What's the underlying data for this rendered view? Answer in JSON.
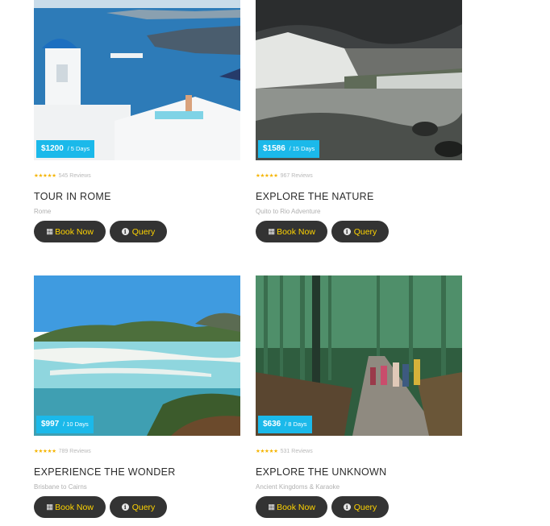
{
  "tours": [
    {
      "price": "$1200",
      "duration": "/ 5 Days",
      "reviews": "545 Reviews",
      "title": "TOUR IN ROME",
      "subtitle": "Rome",
      "book_label": "Book Now",
      "query_label": "Query",
      "image": "santorini-blue-dome-photo"
    },
    {
      "price": "$1586",
      "duration": "/ 15 Days",
      "reviews": "967 Reviews",
      "title": "EXPLORE THE NATURE",
      "subtitle": "Quito to Rio Adventure",
      "book_label": "Book Now",
      "query_label": "Query",
      "image": "waterfall-photo"
    },
    {
      "price": "$997",
      "duration": "/ 10 Days",
      "reviews": "789 Reviews",
      "title": "EXPERIENCE THE WONDER",
      "subtitle": "Brisbane to Cairns",
      "book_label": "Book Now",
      "query_label": "Query",
      "image": "whitehaven-beach-photo"
    },
    {
      "price": "$636",
      "duration": "/ 8 Days",
      "reviews": "531 Reviews",
      "title": "EXPLORE THE UNKNOWN",
      "subtitle": "Ancient Kingdoms & Karaoke",
      "book_label": "Book Now",
      "query_label": "Query",
      "image": "bamboo-forest-photo"
    }
  ],
  "stars": "★★★★★",
  "rating_stars": 5,
  "icons": {
    "book": "calendar-icon",
    "query": "info-icon"
  },
  "colors": {
    "badge": "#1bb9ea",
    "button_bg": "#333333",
    "button_text": "#ffd400",
    "stars": "#f5b400"
  }
}
